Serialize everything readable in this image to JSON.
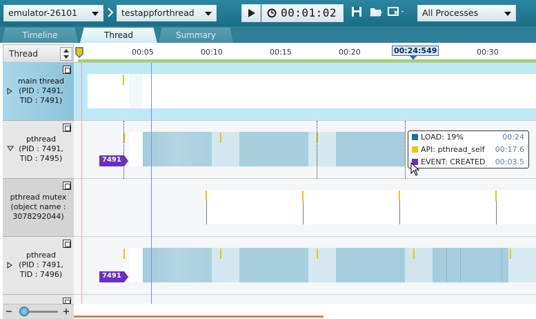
{
  "toolbar": {
    "device": "emulator-26101",
    "app": "testappforthread",
    "elapsed": "00:01:02",
    "process_filter": "All Processes"
  },
  "tabs": [
    {
      "label": "Timeline",
      "active": false
    },
    {
      "label": "Thread",
      "active": true
    },
    {
      "label": "Summary",
      "active": false
    }
  ],
  "header": {
    "column_label": "Thread",
    "ticks": [
      "00:05",
      "00:10",
      "00:15",
      "00:20",
      "00:30"
    ],
    "cursor_time": "00:24:549"
  },
  "rows": [
    {
      "name": "main thread",
      "detail1": "(PID : 7491,",
      "detail2": "TID : 7491)",
      "expanded": false,
      "selected": true
    },
    {
      "name": "pthread",
      "detail1": "(PID : 7491,",
      "detail2": "TID : 7495)",
      "expanded": true,
      "tid_badge": "7491"
    },
    {
      "name": "pthread mutex",
      "detail1": "(object name :",
      "detail2": "3078292044)",
      "expanded": false
    },
    {
      "name": "pthread",
      "detail1": "(PID : 7491,",
      "detail2": "TID : 7496)",
      "expanded": false,
      "tid_badge": "7491"
    }
  ],
  "tooltip": {
    "items": [
      {
        "label": "LOAD: 19%",
        "value": "00:24",
        "color": "#1f6fa3"
      },
      {
        "label": "API: pthread_self",
        "value": "00:17.6",
        "color": "#f5c400"
      },
      {
        "label": "EVENT: CREATED",
        "value": "00:03.5",
        "color": "#6b2fc4"
      }
    ]
  },
  "colors": {
    "toolbar": "#1f7891",
    "load_bar": "#9cc9dc",
    "api_marker": "#f5c400",
    "event_badge": "#6b2fc4",
    "selected_row": "#b7dff0"
  },
  "icons": [
    "chevron-right-icon",
    "play-icon",
    "clock-icon",
    "save-icon",
    "open-folder-icon",
    "screenshot-icon",
    "sort-icon",
    "expand-icon",
    "zoom-out-icon",
    "zoom-in-icon",
    "mouse-cursor-icon"
  ]
}
